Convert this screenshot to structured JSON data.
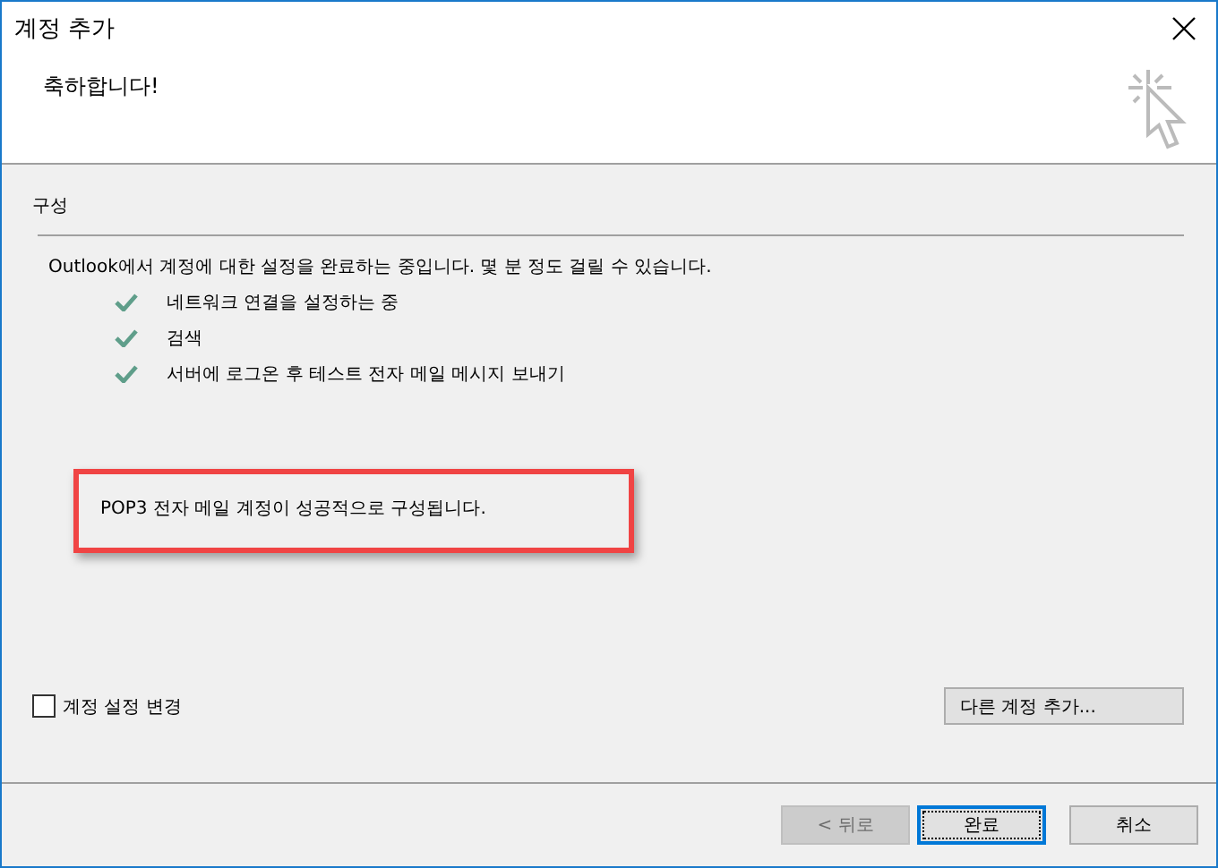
{
  "window": {
    "title": "계정 추가"
  },
  "header": {
    "heading": "축하합니다!"
  },
  "section": {
    "title": "구성"
  },
  "intro": "Outlook에서 계정에 대한 설정을 완료하는 중입니다. 몇 분 정도 걸릴 수 있습니다.",
  "steps": [
    {
      "label": "네트워크 연결을 설정하는 중",
      "done": true
    },
    {
      "label": "검색",
      "done": true
    },
    {
      "label": "서버에 로그온 후 테스트 전자 메일 메시지 보내기",
      "done": true
    }
  ],
  "result": {
    "message": "POP3 전자 메일 계정이 성공적으로 구성됩니다.",
    "highlighted": true
  },
  "change_settings": {
    "label": "계정 설정 변경",
    "checked": false
  },
  "add_another": {
    "label": "다른 계정 추가..."
  },
  "buttons": [
    {
      "label": "< 뒤로",
      "disabled": true,
      "default": false
    },
    {
      "label": "완료",
      "disabled": false,
      "default": true
    },
    {
      "label": "취소",
      "disabled": false,
      "default": false
    }
  ]
}
